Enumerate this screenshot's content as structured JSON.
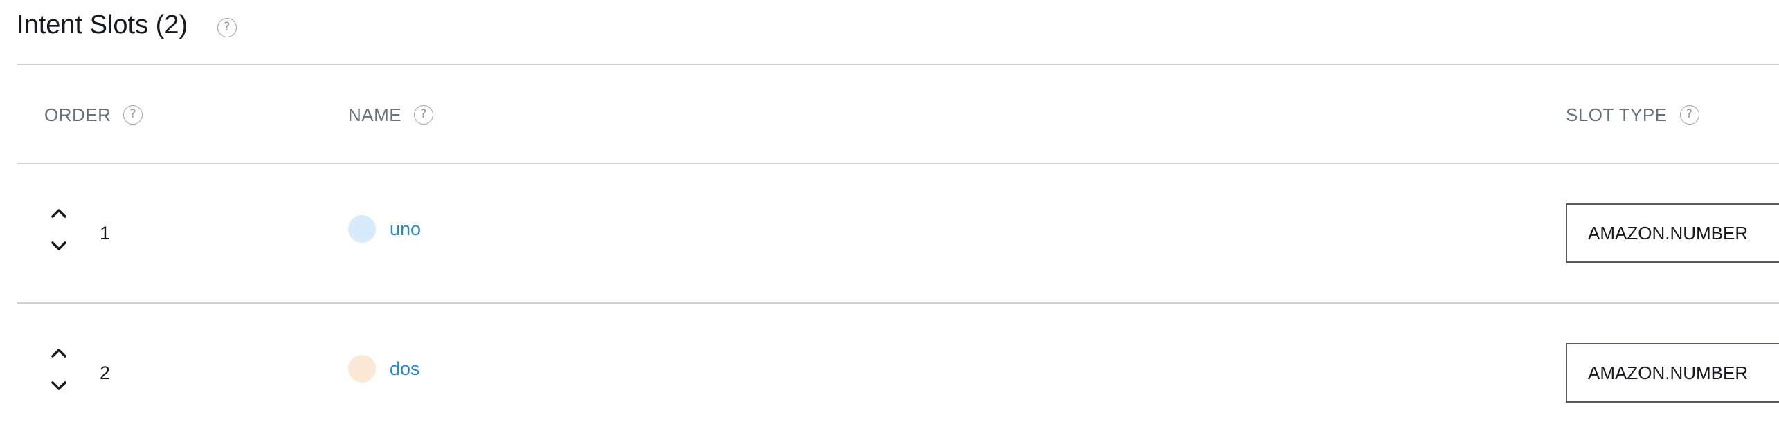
{
  "section": {
    "title": "Intent Slots (2)",
    "help_icon": "help-circle-icon"
  },
  "table": {
    "headers": {
      "order": "ORDER",
      "name": "NAME",
      "slot_type": "SLOT TYPE"
    },
    "rows": [
      {
        "order": "1",
        "name": "uno",
        "slot_type": "AMAZON.NUMBER",
        "dot_color": "#d7ebfb"
      },
      {
        "order": "2",
        "name": "dos",
        "slot_type": "AMAZON.NUMBER",
        "dot_color": "#fbe8d6"
      }
    ]
  },
  "icons": {
    "help": "?",
    "move_up": "chevron-up-icon",
    "move_down": "chevron-down-icon"
  },
  "colors": {
    "link": "#2a8ac8",
    "header_text": "#687078",
    "divider": "#cfd3d6",
    "input_border": "#545b64"
  }
}
